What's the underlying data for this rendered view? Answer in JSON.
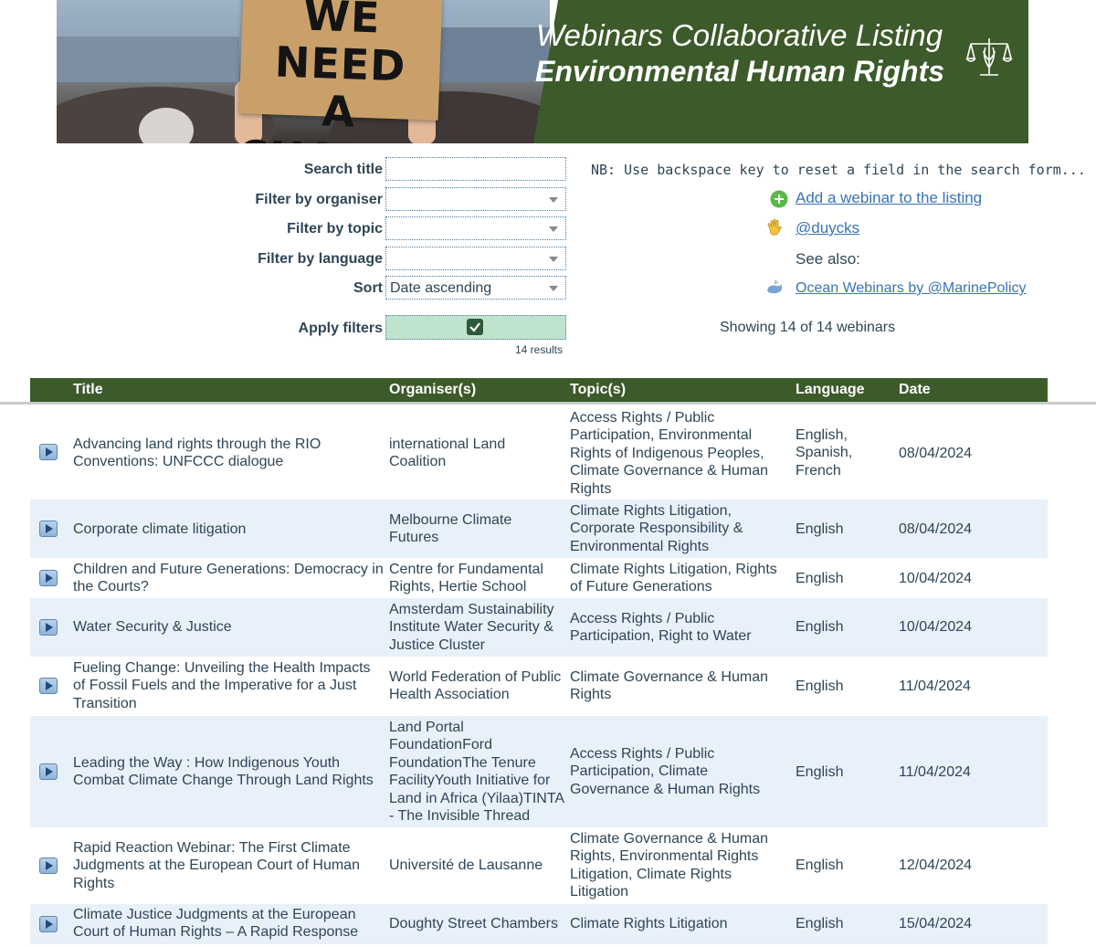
{
  "banner": {
    "sign_line1": "WE NEED",
    "sign_line2": "A CHANGE",
    "title_line1": "Webinars Collaborative Listing",
    "title_line2": "Environmental Human Rights",
    "logo_icon": "scales-of-justice-icon"
  },
  "form": {
    "search_title_label": "Search title",
    "search_title_value": "",
    "organiser_label": "Filter by organiser",
    "organiser_value": "",
    "topic_label": "Filter by topic",
    "topic_value": "",
    "language_label": "Filter by language",
    "language_value": "",
    "sort_label": "Sort",
    "sort_value": "Date ascending",
    "apply_label": "Apply filters",
    "results_text": "14 results"
  },
  "side": {
    "nb_text": "NB: Use backspace key to reset a field in the search form...",
    "add_link": "Add a webinar to the listing",
    "handle_link": "@duycks",
    "see_also": "See also:",
    "ocean_link": "Ocean Webinars by @MarinePolicy",
    "showing": "Showing 14 of 14 webinars"
  },
  "table": {
    "headers": {
      "title": "Title",
      "organiser": "Organiser(s)",
      "topic": "Topic(s)",
      "language": "Language",
      "date": "Date"
    },
    "rows": [
      {
        "title": "Advancing land rights through the RIO Conventions: UNFCCC dialogue",
        "organiser": "international Land Coalition",
        "topic": "Access Rights / Public Participation, Environmental Rights of Indigenous Peoples, Climate Governance & Human Rights",
        "language": "English, Spanish, French",
        "date": "08/04/2024"
      },
      {
        "title": "Corporate climate litigation",
        "organiser": "Melbourne Climate Futures",
        "topic": "Climate Rights Litigation, Corporate Responsibility & Environmental Rights",
        "language": "English",
        "date": "08/04/2024"
      },
      {
        "title": "Children and Future Generations: Democracy in the Courts?",
        "organiser": "Centre for Fundamental Rights, Hertie School",
        "topic": "Climate Rights Litigation, Rights of Future Generations",
        "language": "English",
        "date": "10/04/2024"
      },
      {
        "title": "Water Security & Justice",
        "organiser": "Amsterdam Sustainability Institute Water Security & Justice Cluster",
        "topic": "Access Rights / Public Participation, Right to Water",
        "language": "English",
        "date": "10/04/2024"
      },
      {
        "title": "Fueling Change: Unveiling the Health Impacts of Fossil Fuels and the Imperative for a Just Transition",
        "organiser": "World Federation of Public Health Association",
        "topic": "Climate Governance & Human Rights",
        "language": "English",
        "date": "11/04/2024"
      },
      {
        "title": "Leading the Way : How Indigenous Youth Combat Climate Change Through Land Rights",
        "organiser": "Land Portal FoundationFord FoundationThe Tenure FacilityYouth Initiative for Land in Africa (Yilaa)TINTA - The Invisible Thread",
        "topic": "Access Rights / Public Participation, Climate Governance & Human Rights",
        "language": "English",
        "date": "11/04/2024"
      },
      {
        "title": "Rapid Reaction Webinar: The First Climate Judgments at the European Court of Human Rights",
        "organiser": "Université de Lausanne",
        "topic": "Climate Governance & Human Rights, Environmental Rights Litigation, Climate Rights Litigation",
        "language": "English",
        "date": "12/04/2024"
      },
      {
        "title": "Climate Justice Judgments at the European Court of Human Rights – A Rapid Response",
        "organiser": "Doughty Street Chambers",
        "topic": "Climate Rights Litigation",
        "language": "English",
        "date": "15/04/2024"
      }
    ]
  },
  "colors": {
    "header_green": "#3c5a2a",
    "alt_row": "#e8f0fa",
    "link_blue": "#3a73b6",
    "apply_green": "#bfe3cd"
  }
}
